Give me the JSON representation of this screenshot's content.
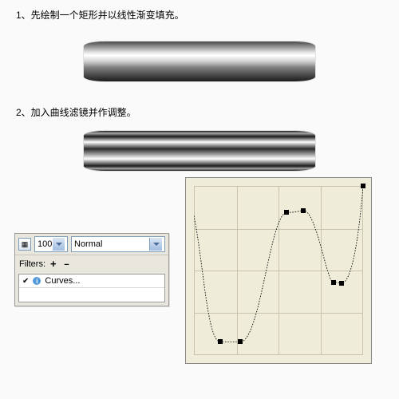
{
  "step1": "1、先绘制一个矩形并以线性渐变填充。",
  "step2": "2、加入曲线滤镜并作调整。",
  "panel": {
    "opacity": "100",
    "blend": "Normal",
    "filters_label": "Filters:",
    "filter_item": "Curves..."
  },
  "chart_data": {
    "type": "line",
    "title": "",
    "xlabel": "",
    "ylabel": "",
    "xlim": [
      0,
      255
    ],
    "ylim": [
      0,
      255
    ],
    "points": [
      {
        "x": 0,
        "y": 210
      },
      {
        "x": 40,
        "y": 20
      },
      {
        "x": 70,
        "y": 20
      },
      {
        "x": 140,
        "y": 215
      },
      {
        "x": 165,
        "y": 218
      },
      {
        "x": 210,
        "y": 110
      },
      {
        "x": 222,
        "y": 108
      },
      {
        "x": 255,
        "y": 255
      }
    ]
  }
}
